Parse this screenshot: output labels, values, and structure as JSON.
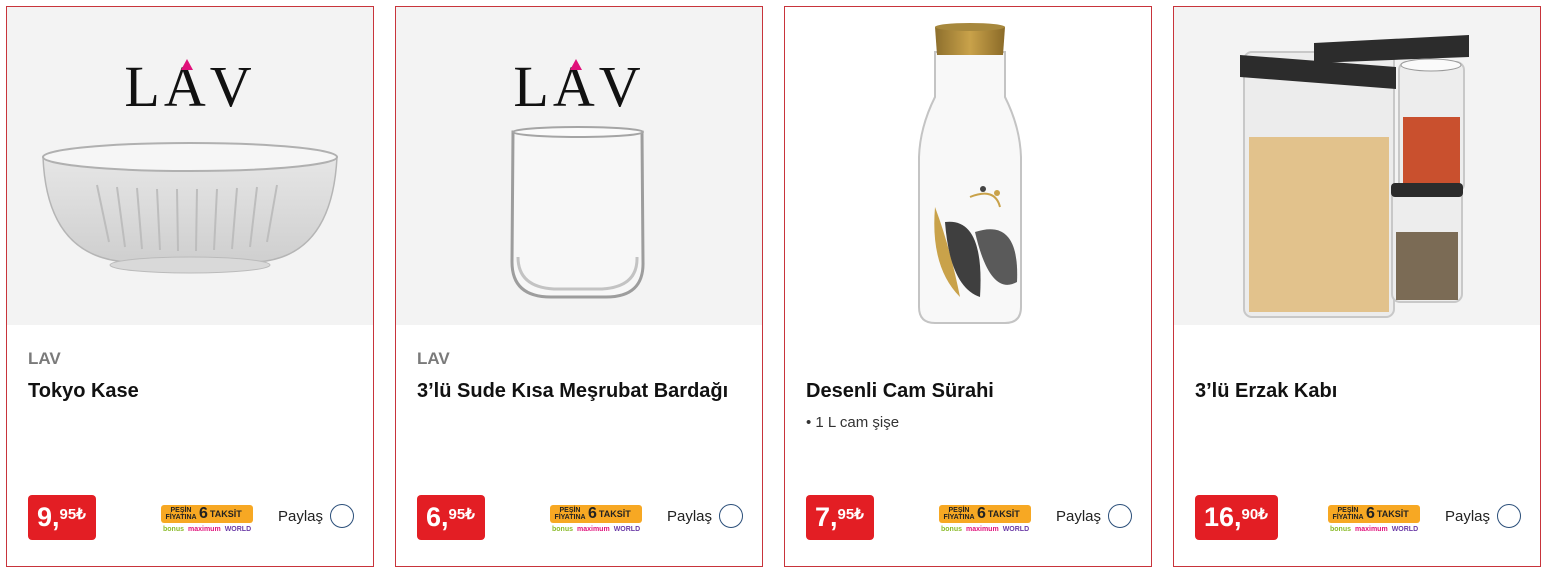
{
  "products": [
    {
      "brand": "LAV",
      "logo": "LAV",
      "title": "Tokyo Kase",
      "bullet": "",
      "price_int": "9,",
      "price_dec": "95₺",
      "share_label": "Paylaş"
    },
    {
      "brand": "LAV",
      "logo": "LAV",
      "title": "3’lü Sude Kısa Meşrubat Bardağı",
      "bullet": "",
      "price_int": "6,",
      "price_dec": "95₺",
      "share_label": "Paylaş"
    },
    {
      "brand": "",
      "logo": "",
      "title": "Desenli Cam Sürahi",
      "bullet": "• 1 L cam şişe",
      "price_int": "7,",
      "price_dec": "95₺",
      "share_label": "Paylaş"
    },
    {
      "brand": "",
      "logo": "",
      "title": "3’lü Erzak Kabı",
      "bullet": "",
      "price_int": "16,",
      "price_dec": "90₺",
      "share_label": "Paylaş"
    }
  ],
  "installment_badge": {
    "pesin_line1": "PEŞİN",
    "pesin_line2": "FİYATINA",
    "count": "6",
    "label": "TAKSİT",
    "card1": "bonus",
    "card2": "maximum",
    "card3": "WORLD"
  },
  "colors": {
    "card_border": "#c8343b",
    "price_bg": "#e31e24",
    "badge_bg": "#f7a823",
    "share_circle": "#2b4f7a"
  }
}
